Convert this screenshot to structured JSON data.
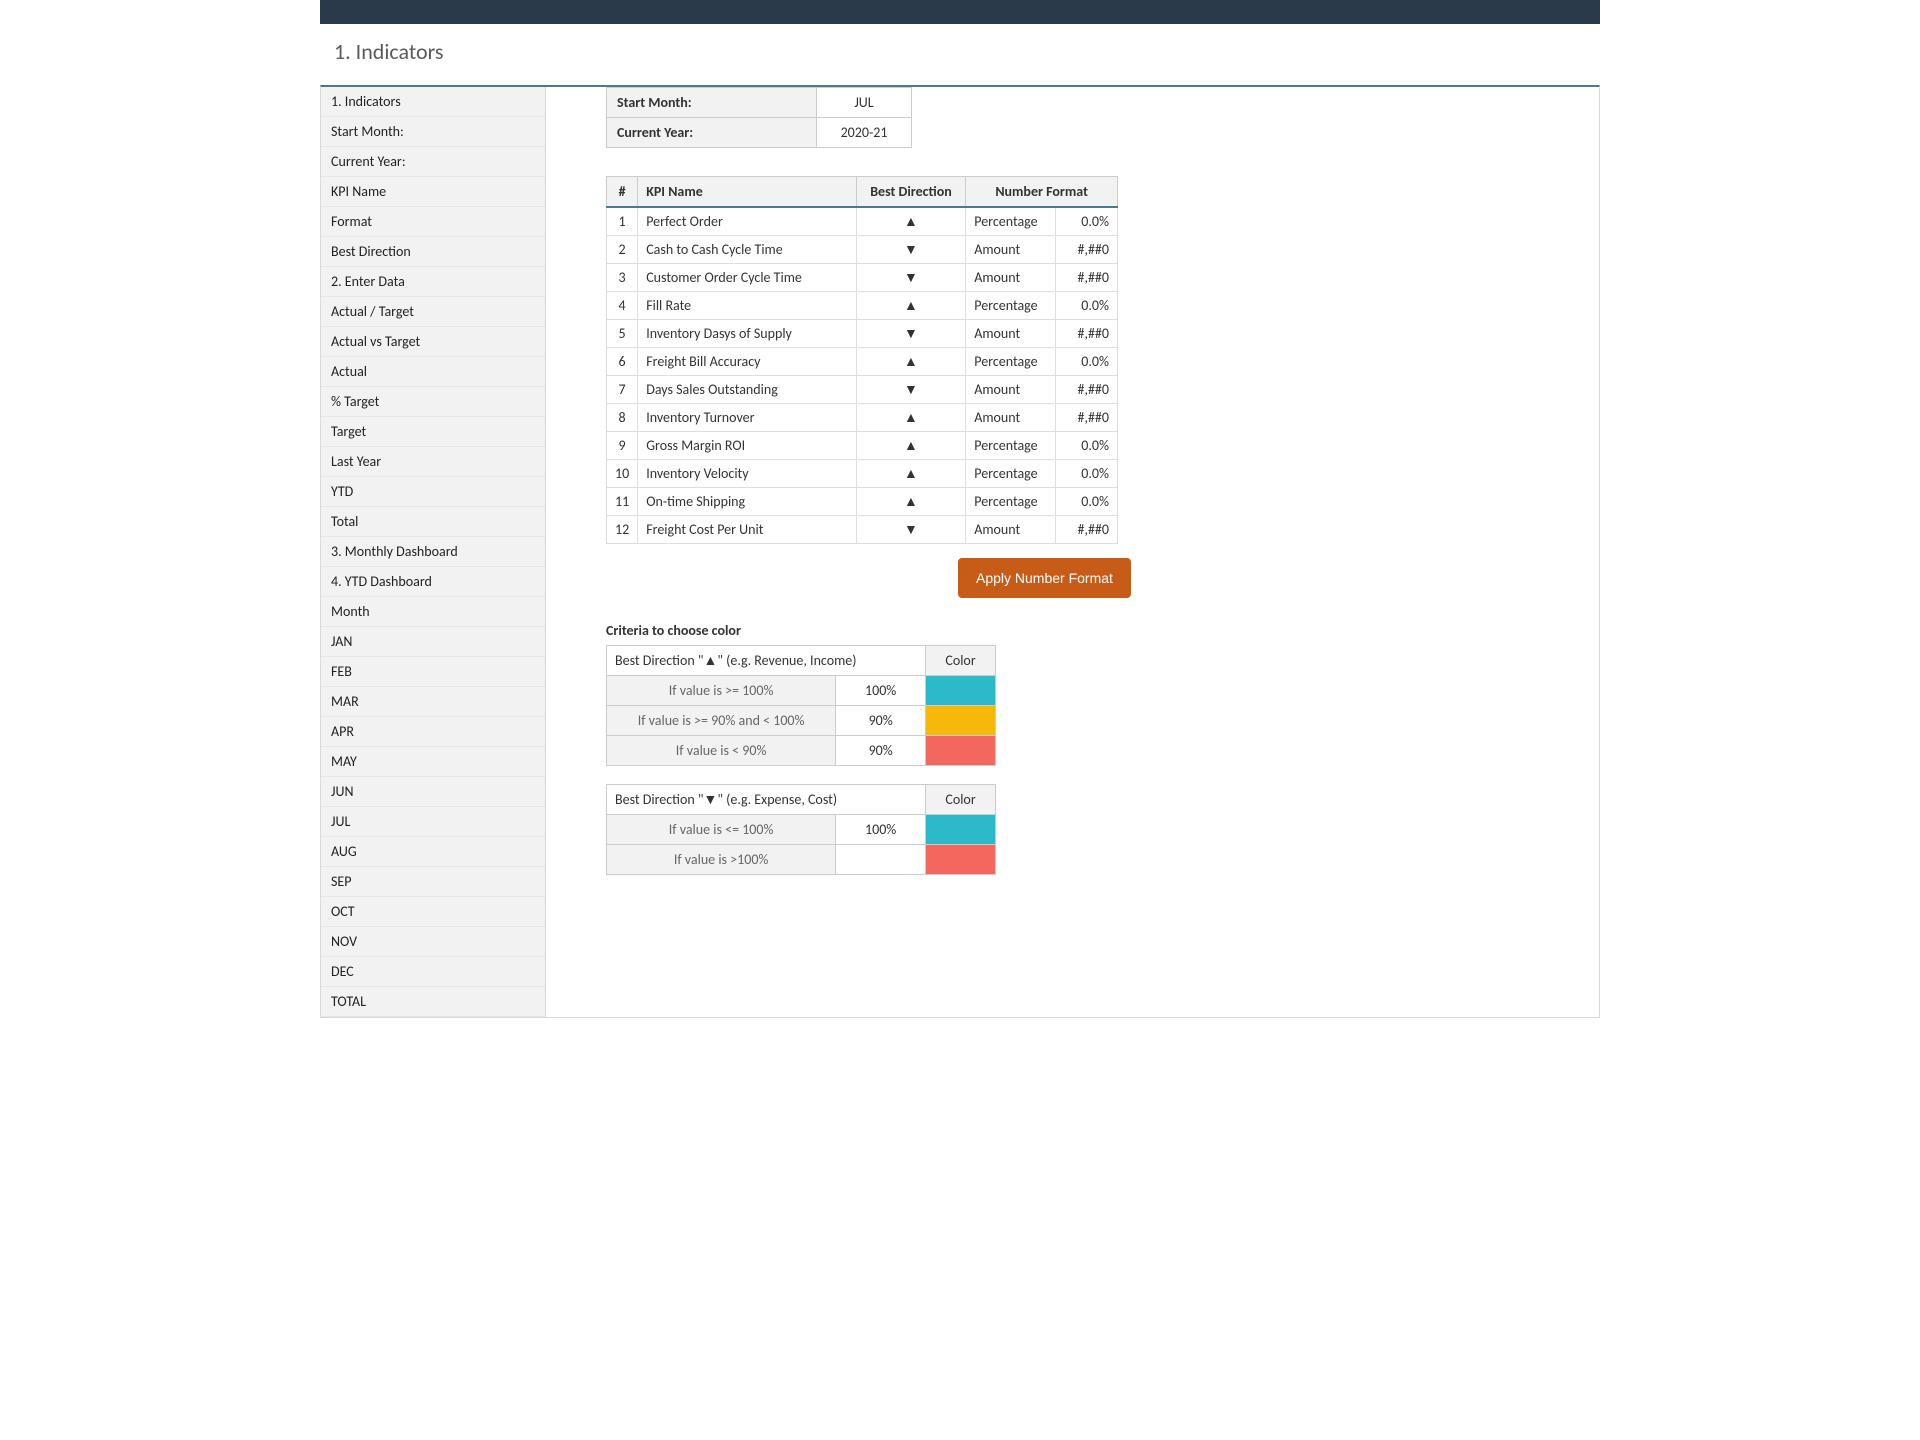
{
  "heading": "1. Indicators",
  "sidebar": {
    "items": [
      "1. Indicators",
      "Start Month:",
      "Current Year:",
      "KPI Name",
      "Format",
      "Best Direction",
      "2. Enter Data",
      "Actual / Target",
      "Actual vs Target",
      "Actual",
      "% Target",
      "Target",
      "Last Year",
      "YTD",
      "Total",
      "3. Monthly Dashboard",
      "4. YTD Dashboard",
      "Month",
      "JAN",
      "FEB",
      "MAR",
      "APR",
      "MAY",
      "JUN",
      "JUL",
      "AUG",
      "SEP",
      "OCT",
      "NOV",
      "DEC",
      "TOTAL"
    ]
  },
  "props": {
    "start_month_label": "Start Month:",
    "start_month_value": "JUL",
    "current_year_label": "Current Year:",
    "current_year_value": "2020-21"
  },
  "kpi_headers": {
    "num": "#",
    "name": "KPI Name",
    "dir": "Best Direction",
    "fmt": "Number Format"
  },
  "kpi_rows": [
    {
      "n": "1",
      "name": "Perfect Order",
      "dir": "▲",
      "fmt_a": "Percentage",
      "fmt_b": "0.0%"
    },
    {
      "n": "2",
      "name": "Cash to Cash Cycle Time",
      "dir": "▼",
      "fmt_a": "Amount",
      "fmt_b": "#,##0"
    },
    {
      "n": "3",
      "name": "Customer Order Cycle Time",
      "dir": "▼",
      "fmt_a": "Amount",
      "fmt_b": "#,##0"
    },
    {
      "n": "4",
      "name": "Fill Rate",
      "dir": "▲",
      "fmt_a": "Percentage",
      "fmt_b": "0.0%"
    },
    {
      "n": "5",
      "name": "Inventory Dasys of Supply",
      "dir": "▼",
      "fmt_a": "Amount",
      "fmt_b": "#,##0"
    },
    {
      "n": "6",
      "name": "Freight Bill Accuracy",
      "dir": "▲",
      "fmt_a": "Percentage",
      "fmt_b": "0.0%"
    },
    {
      "n": "7",
      "name": "Days Sales Outstanding",
      "dir": "▼",
      "fmt_a": "Amount",
      "fmt_b": "#,##0"
    },
    {
      "n": "8",
      "name": "Inventory Turnover",
      "dir": "▲",
      "fmt_a": "Amount",
      "fmt_b": "#,##0"
    },
    {
      "n": "9",
      "name": "Gross Margin ROI",
      "dir": "▲",
      "fmt_a": "Percentage",
      "fmt_b": "0.0%"
    },
    {
      "n": "10",
      "name": "Inventory Velocity",
      "dir": "▲",
      "fmt_a": "Percentage",
      "fmt_b": "0.0%"
    },
    {
      "n": "11",
      "name": "On-time Shipping",
      "dir": "▲",
      "fmt_a": "Percentage",
      "fmt_b": "0.0%"
    },
    {
      "n": "12",
      "name": "Freight Cost Per Unit",
      "dir": "▼",
      "fmt_a": "Amount",
      "fmt_b": "#,##0"
    }
  ],
  "apply_btn": "Apply Number Format",
  "criteria_title": "Criteria to choose color",
  "crit_up": {
    "head": "Best Direction \"▲\" (e.g. Revenue, Income)",
    "color_head": "Color",
    "rows": [
      {
        "rule": "If value is >= 100%",
        "val": "100%",
        "color": "teal"
      },
      {
        "rule": "If value is >= 90% and < 100%",
        "val": "90%",
        "color": "amber"
      },
      {
        "rule": "If value is < 90%",
        "val": "90%",
        "color": "red"
      }
    ]
  },
  "crit_down": {
    "head": "Best Direction \"▼\" (e.g. Expense, Cost)",
    "color_head": "Color",
    "rows": [
      {
        "rule": "If value is <= 100%",
        "val": "100%",
        "color": "teal"
      },
      {
        "rule": "If value is >100%",
        "val": "",
        "color": "red"
      }
    ]
  }
}
